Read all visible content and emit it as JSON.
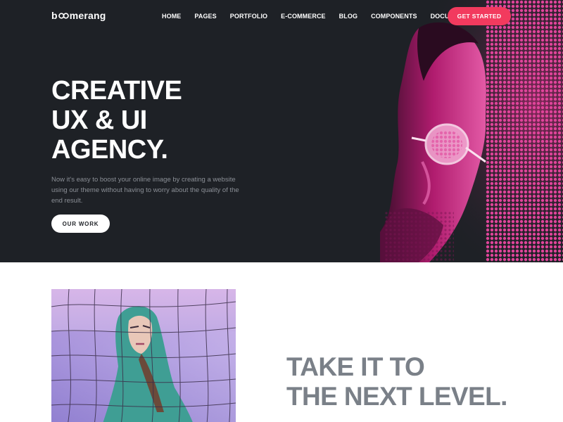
{
  "brand": {
    "logo_pre": "b",
    "logo_post": "merang"
  },
  "nav": {
    "items": [
      "HOME",
      "PAGES",
      "PORTFOLIO",
      "E-COMMERCE",
      "BLOG",
      "COMPONENTS",
      "DOCUMENTATION"
    ],
    "cta_label": "GET STARTED"
  },
  "hero": {
    "title_lines": [
      "CREATIVE",
      "UX & UI",
      "AGENCY."
    ],
    "description": "Now it's easy to boost your online image by creating a website using our theme without having to worry about the quality of the end result.",
    "button_label": "OUR WORK"
  },
  "section2": {
    "heading_lines": [
      "TAKE IT TO",
      "THE NEXT LEVEL."
    ]
  },
  "colors": {
    "hero_bg": "#1e2126",
    "accent": "#f23a5e",
    "portrait_tint": "#c21e7a",
    "heading_gray": "#7a8088",
    "photo_purple": "#8e7fd0",
    "photo_teal": "#3fa39a"
  }
}
